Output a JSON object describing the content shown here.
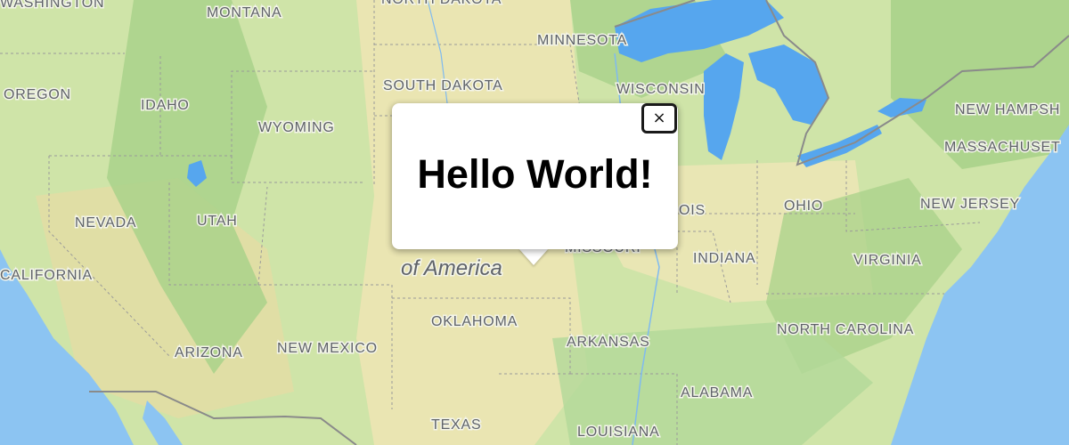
{
  "map": {
    "country_label": "of America",
    "state_labels": {
      "washington": "WASHINGTON",
      "montana": "MONTANA",
      "north_dakota": "NORTH DAKOTA",
      "minnesota": "MINNESOTA",
      "oregon": "OREGON",
      "idaho": "IDAHO",
      "south_dakota": "SOUTH DAKOTA",
      "wisconsin": "WISCONSIN",
      "wyoming": "WYOMING",
      "new_hampshire": "NEW HAMPSH",
      "massachusetts": "MASSACHUSET",
      "nevada": "NEVADA",
      "utah": "UTAH",
      "illinois": "OIS",
      "ohio": "OHIO",
      "new_jersey": "NEW JERSEY",
      "missouri": "MISSOURI",
      "california": "CALIFORNIA",
      "indiana": "INDIANA",
      "virginia": "VIRGINIA",
      "oklahoma": "OKLAHOMA",
      "arizona": "ARIZONA",
      "new_mexico": "NEW MEXICO",
      "arkansas": "ARKANSAS",
      "north_carolina": "NORTH CAROLINA",
      "alabama": "ALABAMA",
      "texas": "TEXAS",
      "louisiana": "LOUISIANA"
    },
    "colors": {
      "land": "#cfe4a8",
      "water": "#8cc4f2",
      "lakes": "#56a6ee",
      "dry": "#efe6b8",
      "forest": "#a9d48a",
      "border": "#8a8a8a"
    }
  },
  "info_window": {
    "content": "Hello World!",
    "close_symbol": "×"
  }
}
